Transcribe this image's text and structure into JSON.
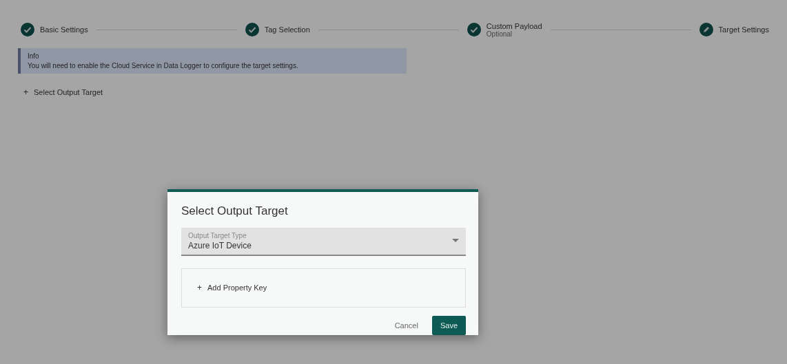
{
  "stepper": [
    {
      "label": "Basic Settings",
      "completed": true
    },
    {
      "label": "Tag Selection",
      "completed": true
    },
    {
      "label": "Custom Payload",
      "sublabel": "Optional",
      "completed": true
    },
    {
      "label": "Target Settings",
      "completed": false
    }
  ],
  "info": {
    "title": "Info",
    "text": "You will need to enable the Cloud Service in Data Logger to configure the target settings."
  },
  "add_target_link": {
    "icon": "+",
    "label": "Select Output Target"
  },
  "dialog": {
    "title": "Select Output Target",
    "field": {
      "label": "Output Target Type",
      "value": "Azure IoT Device"
    },
    "add_property_link": {
      "icon": "+",
      "label": "Add Property Key"
    },
    "buttons": [
      {
        "label": "Cancel",
        "kind": "text"
      },
      {
        "label": "Save",
        "kind": "primary"
      }
    ]
  }
}
